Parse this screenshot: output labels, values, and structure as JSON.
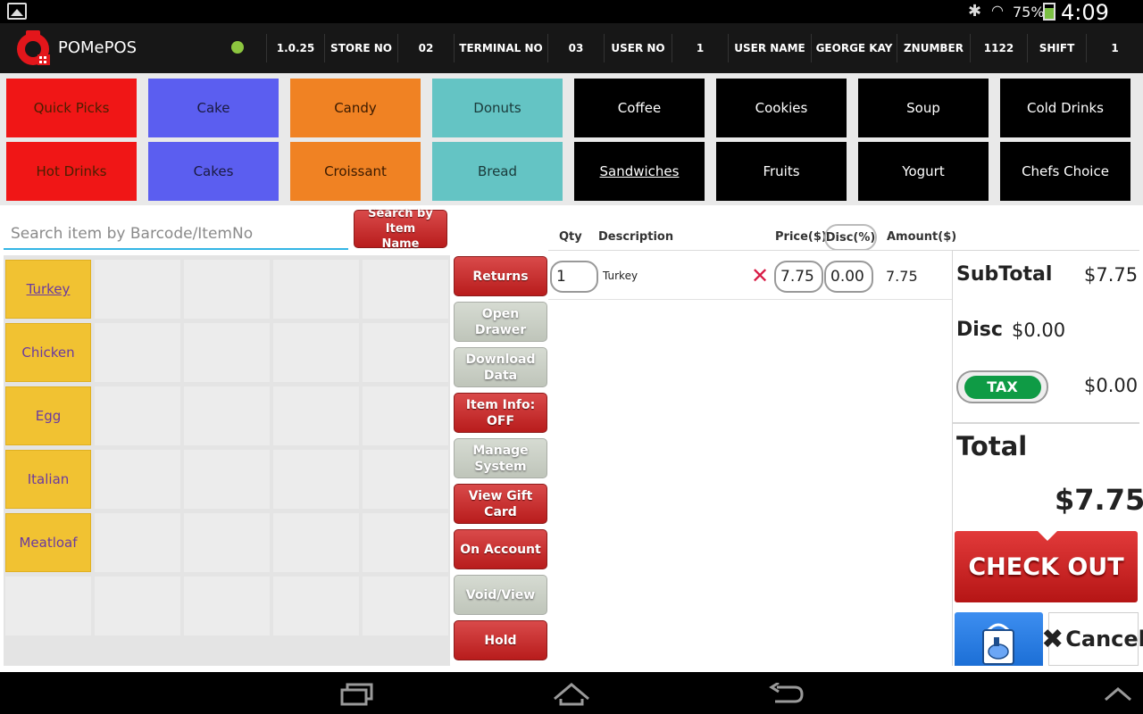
{
  "status_bar": {
    "battery_percent": "75%",
    "battery_level": 0.75,
    "time": "4:09 PM"
  },
  "header": {
    "app_name": "POMePOS",
    "version": "1.0.25",
    "store_label": "STORE NO",
    "store_value": "02",
    "terminal_label": "TERMINAL NO",
    "terminal_value": "03",
    "user_no_label": "USER NO",
    "user_no_value": "1",
    "user_name_label": "USER NAME",
    "user_name_value": "GEORGE KAY",
    "znumber_label": "ZNUMBER",
    "znumber_value": "1122",
    "shift_label": "SHIFT",
    "shift_value": "1"
  },
  "categories": [
    {
      "label": "Quick Picks",
      "bg": "#f01616",
      "fg": "#4a1f00"
    },
    {
      "label": "Cake",
      "bg": "#5b5ef0",
      "fg": "#1a1a40"
    },
    {
      "label": "Candy",
      "bg": "#f08223",
      "fg": "#3a1a00"
    },
    {
      "label": "Donuts",
      "bg": "#64c4c4",
      "fg": "#1a3a3a"
    },
    {
      "label": "Coffee",
      "bg": "#000000",
      "fg": "#ffffff"
    },
    {
      "label": "Cookies",
      "bg": "#000000",
      "fg": "#ffffff"
    },
    {
      "label": "Soup",
      "bg": "#000000",
      "fg": "#ffffff"
    },
    {
      "label": "Cold Drinks",
      "bg": "#000000",
      "fg": "#ffffff"
    },
    {
      "label": "Hot Drinks",
      "bg": "#f01616",
      "fg": "#4a1f00"
    },
    {
      "label": "Cakes",
      "bg": "#5b5ef0",
      "fg": "#1a1a40"
    },
    {
      "label": "Croissant",
      "bg": "#f08223",
      "fg": "#3a1a00"
    },
    {
      "label": "Bread",
      "bg": "#64c4c4",
      "fg": "#1a3a3a"
    },
    {
      "label": "Sandwiches",
      "bg": "#000000",
      "fg": "#ffffff",
      "selected": true
    },
    {
      "label": "Fruits",
      "bg": "#000000",
      "fg": "#ffffff"
    },
    {
      "label": "Yogurt",
      "bg": "#000000",
      "fg": "#ffffff"
    },
    {
      "label": "Chefs Choice",
      "bg": "#000000",
      "fg": "#ffffff"
    }
  ],
  "search": {
    "placeholder": "Search item by Barcode/ItemNo",
    "value": "",
    "by_name_line1": "Search by Item",
    "by_name_line2": "Name"
  },
  "items": [
    "Turkey",
    "Chicken",
    "Egg",
    "Italian",
    "Meatloaf"
  ],
  "actions": [
    {
      "label": "Returns",
      "style": "red"
    },
    {
      "label": "Open Drawer",
      "style": "grey"
    },
    {
      "label": "Download Data",
      "style": "grey"
    },
    {
      "label": "Item Info: OFF",
      "style": "red"
    },
    {
      "label": "Manage System",
      "style": "grey"
    },
    {
      "label": "View Gift Card",
      "style": "red"
    },
    {
      "label": "On Account",
      "style": "red"
    },
    {
      "label": "Void/View",
      "style": "grey"
    },
    {
      "label": "Hold",
      "style": "red"
    }
  ],
  "order": {
    "headers": {
      "qty": "Qty",
      "description": "Description",
      "price": "Price($)",
      "disc": "Disc(%)",
      "amount": "Amount($)"
    },
    "rows": [
      {
        "qty": "1",
        "description": "Turkey",
        "price": "7.75",
        "disc": "0.00",
        "amount": "7.75"
      }
    ]
  },
  "summary": {
    "subtotal_label": "SubTotal",
    "subtotal_value": "$7.75",
    "disc_label": "Disc",
    "disc_value": "$0.00",
    "tax_label": "TAX",
    "tax_value": "$0.00",
    "total_label": "Total",
    "total_value": "$7.75"
  },
  "checkout_label": "CHECK OUT",
  "cancel_label": "Cancel"
}
